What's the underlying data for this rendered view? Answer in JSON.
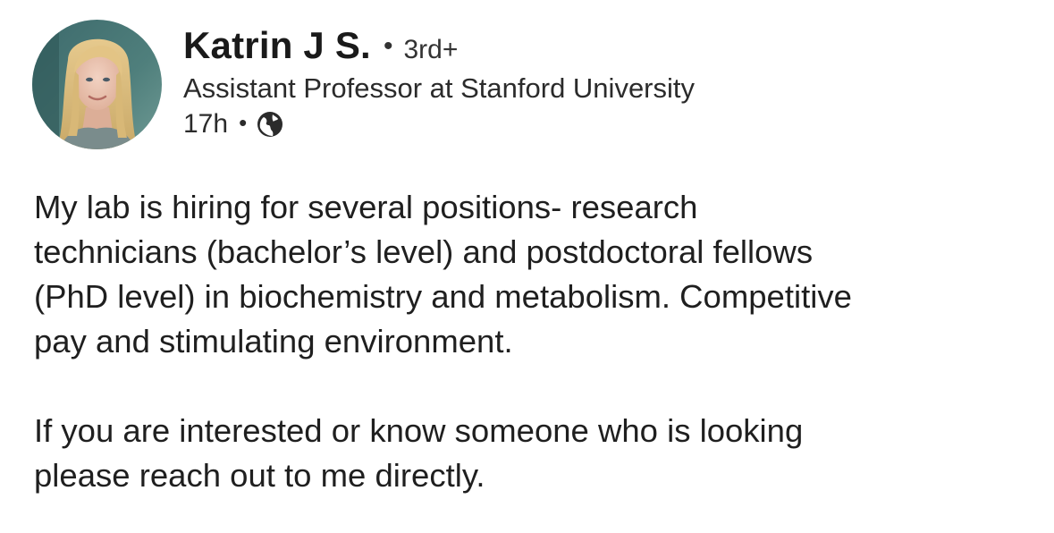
{
  "post": {
    "author": {
      "name": "Katrin J S.",
      "separator": "•",
      "degree": "3rd+",
      "headline": "Assistant Professor at Stanford University",
      "avatar_icon": "profile-photo"
    },
    "timestamp": {
      "age": "17h",
      "separator": "•",
      "visibility_icon": "globe-icon"
    },
    "paragraphs": [
      "My lab is hiring for several positions- research\ntechnicians (bachelor’s level) and postdoctoral fellows\n(PhD level) in biochemistry and metabolism. Competitive\npay and stimulating environment.",
      "If you are interested or know someone who is looking\nplease reach out to me directly."
    ]
  },
  "colors": {
    "text": "#1f1f1f",
    "background": "#ffffff"
  }
}
